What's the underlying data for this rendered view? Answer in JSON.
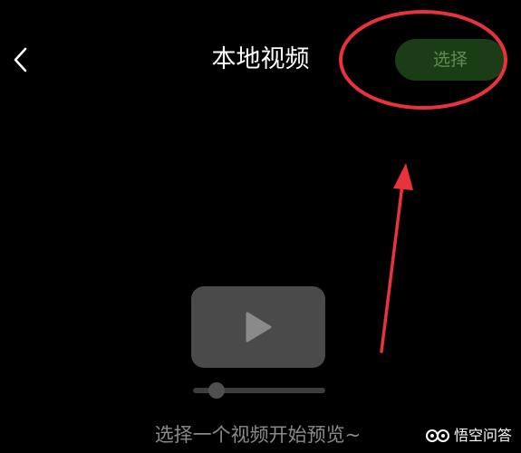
{
  "header": {
    "back_icon": "chevron-left-icon",
    "title": "本地视频",
    "select_label": "选择"
  },
  "player": {
    "play_icon": "play-icon",
    "hint": "选择一个视频开始预览~"
  },
  "watermark": {
    "logo_icon": "wukong-logo-icon",
    "text": "悟空问答"
  },
  "colors": {
    "background": "#000000",
    "select_button_bg": "#1b3d15",
    "select_button_text": "#5f8a56",
    "annotation": "#e8323c",
    "placeholder": "#4a4a4a",
    "hint_text": "#8a8a8a"
  }
}
